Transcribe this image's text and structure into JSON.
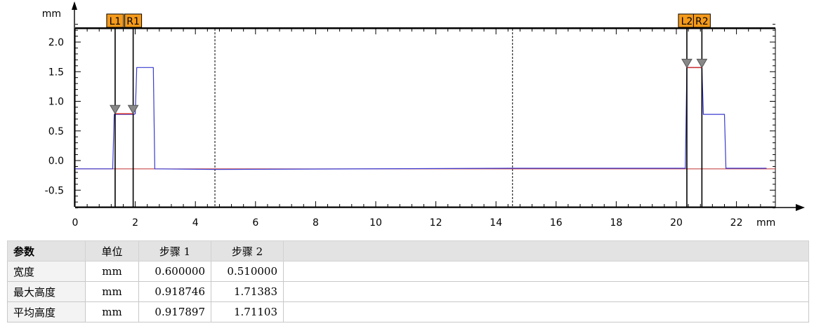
{
  "chart_data": {
    "type": "line",
    "y_unit_label": "mm",
    "x_unit_label": "mm",
    "xlim": [
      0,
      23
    ],
    "ylim": [
      -0.8,
      2.3
    ],
    "x_ticks": [
      0,
      2,
      4,
      6,
      8,
      10,
      12,
      14,
      16,
      18,
      20,
      22
    ],
    "x_tick_labels": [
      "0",
      "2",
      "4",
      "6",
      "8",
      "10",
      "12",
      "14",
      "16",
      "18",
      "20",
      "22"
    ],
    "y_ticks": [
      2.0,
      1.5,
      1.0,
      0.5,
      0.0,
      -0.5
    ],
    "y_tick_labels": [
      "2.0",
      "1.5",
      "1.0",
      "0.5",
      "0.0",
      "-0.5"
    ],
    "profile": {
      "color": "#3a3ad0",
      "x": [
        0,
        1.25,
        1.3,
        1.95,
        2.0,
        2.05,
        2.6,
        2.65,
        4.65,
        14.55,
        20.3,
        20.35,
        20.85,
        20.9,
        21.6,
        21.65,
        23.0
      ],
      "y": [
        -0.14,
        -0.14,
        0.78,
        0.78,
        0.79,
        1.57,
        1.57,
        -0.14,
        -0.15,
        -0.13,
        -0.13,
        1.57,
        1.57,
        0.78,
        0.78,
        -0.13,
        -0.13
      ]
    },
    "baseline": {
      "color": "#c03030",
      "y": -0.14
    },
    "fit_segments": [
      {
        "color": "#cc3030",
        "x": [
          1.33,
          1.93
        ],
        "y": [
          0.79,
          0.79
        ]
      },
      {
        "color": "#cc3030",
        "x": [
          20.35,
          20.85
        ],
        "y": [
          1.57,
          1.57
        ]
      }
    ],
    "cursors": [
      {
        "label": "L1",
        "x": 1.33,
        "marker_y": 0.79
      },
      {
        "label": "R1",
        "x": 1.93,
        "marker_y": 0.79
      },
      {
        "label": "L2",
        "x": 20.35,
        "marker_y": 1.57
      },
      {
        "label": "R2",
        "x": 20.85,
        "marker_y": 1.57
      }
    ],
    "dashed_lines_x": [
      4.65,
      14.55
    ],
    "cursor_label_color": "#f59a1a"
  },
  "table": {
    "headers": [
      "参数",
      "单位",
      "步骤 1",
      "步骤 2"
    ],
    "rows": [
      {
        "name": "宽度",
        "unit": "mm",
        "step1": "0.600000",
        "step2": "0.510000"
      },
      {
        "name": "最大高度",
        "unit": "mm",
        "step1": "0.918746",
        "step2": "1.71383"
      },
      {
        "name": "平均高度",
        "unit": "mm",
        "step1": "0.917897",
        "step2": "1.71103"
      }
    ]
  }
}
